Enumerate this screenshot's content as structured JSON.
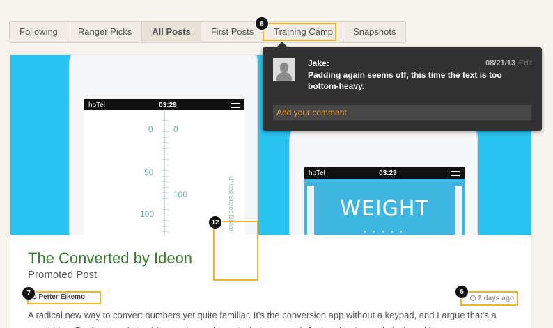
{
  "tabs": [
    "Following",
    "Ranger Picks",
    "All Posts",
    "First Posts",
    "Training Camp",
    "Snapshots"
  ],
  "active_tab": "All Posts",
  "hero": {
    "phone1": {
      "carrier": "hpTel",
      "time": "03:29",
      "ruler_left": [
        "0",
        "50",
        "100"
      ],
      "ruler_right": [
        "0",
        "100"
      ],
      "vertical_label": "United States Dollar"
    },
    "phone2": {
      "carrier": "hpTel",
      "time": "03:29",
      "title": "WEIGHT",
      "dots": "• • • • •"
    }
  },
  "post": {
    "title": "The Converted by Ideon",
    "subtitle": "Promoted Post",
    "author": "ns Petter Eikemo",
    "time_ago": "2 days ago",
    "description": "A radical new way to convert numbers yet quite familiar. It's the conversion app without a keypad, and I argue that's a good thing: Don't trot and stumble on a keypad to get what you need. Just and swipe and pinch and have"
  },
  "comment": {
    "author": "Jake:",
    "date": "08/21/13",
    "edit_label": "Edit",
    "text": "Padding again seems off, this time the text is too bottom-heavy.",
    "input_placeholder": "Add your comment"
  },
  "annotations": [
    "6",
    "7",
    "8",
    "12"
  ],
  "colors": {
    "hero_bg": "#29c3f0",
    "title_green": "#3a7d32",
    "highlight": "#f0b429",
    "comment_accent": "#e8a23a"
  }
}
